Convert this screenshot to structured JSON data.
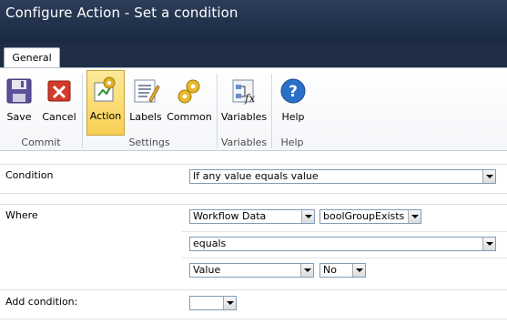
{
  "window": {
    "title": "Configure Action - Set a condition"
  },
  "tabs": [
    {
      "label": "General"
    }
  ],
  "ribbon": {
    "buttons": {
      "save": "Save",
      "cancel": "Cancel",
      "action": "Action",
      "labels": "Labels",
      "common": "Common",
      "variables": "Variables",
      "help": "Help"
    },
    "groups": {
      "commit": "Commit",
      "settings": "Settings",
      "variables": "Variables",
      "help": "Help"
    }
  },
  "form": {
    "condition": {
      "label": "Condition",
      "value": "If any value equals value"
    },
    "where": {
      "label": "Where",
      "source": "Workflow Data",
      "field": "boolGroupExists",
      "operator": "equals",
      "value_type": "Value",
      "value": "No"
    },
    "add_condition": {
      "label": "Add condition:",
      "value": ""
    }
  }
}
